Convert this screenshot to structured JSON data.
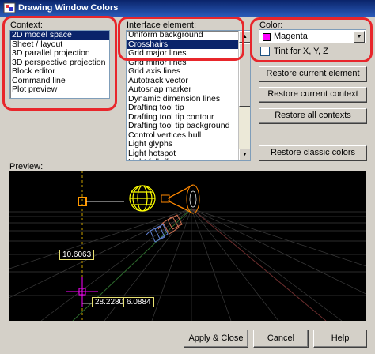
{
  "window": {
    "title": "Drawing Window Colors"
  },
  "context": {
    "label": "Context:",
    "items": [
      "2D model space",
      "Sheet / layout",
      "3D parallel projection",
      "3D perspective projection",
      "Block editor",
      "Command line",
      "Plot preview"
    ],
    "selected_index": 0
  },
  "interface": {
    "label": "Interface element:",
    "items": [
      "Uniform background",
      "Crosshairs",
      "Grid major lines",
      "Grid minor lines",
      "Grid axis lines",
      "Autotrack vector",
      "Autosnap marker",
      "Dynamic dimension lines",
      "Drafting tool tip",
      "Drafting tool tip contour",
      "Drafting tool tip background",
      "Control vertices hull",
      "Light glyphs",
      "Light hotspot",
      "Light falloff"
    ],
    "selected_index": 1
  },
  "color": {
    "label": "Color:",
    "value": "Magenta",
    "swatch": "#ff00ff",
    "tint_label": "Tint for X, Y, Z",
    "tint_checked": false
  },
  "buttons": {
    "restore_element": "Restore current element",
    "restore_context": "Restore current context",
    "restore_all": "Restore all contexts",
    "restore_classic": "Restore classic colors",
    "apply_close": "Apply & Close",
    "cancel": "Cancel",
    "help": "Help"
  },
  "preview": {
    "label": "Preview:",
    "dim1": "10.6063",
    "dim2": "28.2280",
    "dim3": "6.0884"
  },
  "colors": {
    "highlight_ring": "#e8262b",
    "selection": "#0a246a",
    "title_bar": "#0a246a"
  }
}
